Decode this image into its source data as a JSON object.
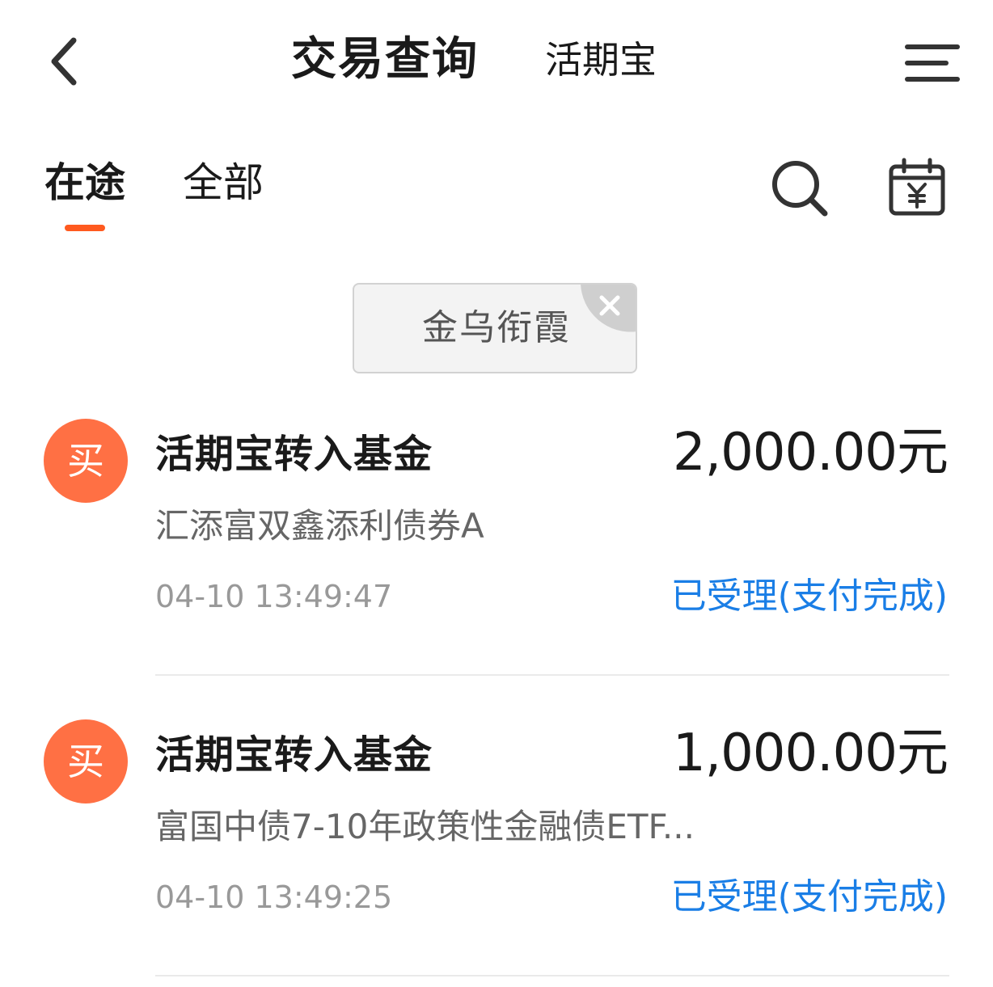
{
  "header": {
    "title": "交易查询",
    "subtitle": "活期宝",
    "back_icon": "chevron-left-icon",
    "menu_icon": "menu-icon"
  },
  "tabs": [
    {
      "label": "在途",
      "active": true
    },
    {
      "label": "全部",
      "active": false
    }
  ],
  "toolbar": {
    "search_icon": "search-icon",
    "calendar_icon": "calendar-yuan-icon"
  },
  "filter_chip": {
    "label": "金乌衔霞",
    "close_icon": "close-icon"
  },
  "transactions": [
    {
      "badge": "买",
      "title": "活期宝转入基金",
      "amount": "2,000.00元",
      "fund": "汇添富双鑫添利债券A",
      "time": "04-10 13:49:47",
      "status": "已受理(支付完成)"
    },
    {
      "badge": "买",
      "title": "活期宝转入基金",
      "amount": "1,000.00元",
      "fund": "富国中债7-10年政策性金融债ETF...",
      "time": "04-10 13:49:25",
      "status": "已受理(支付完成)"
    }
  ],
  "colors": {
    "accent": "#ff5a1f",
    "badge": "#ff7044",
    "status": "#1a7ee6",
    "secondary_text": "#666666",
    "muted_text": "#999999"
  }
}
